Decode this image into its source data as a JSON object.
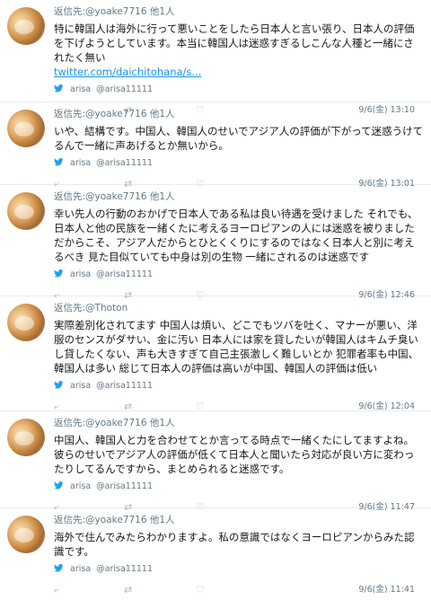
{
  "tweets": [
    {
      "reply_prefix": "返信先:",
      "reply_handle": "@yoake7716",
      "reply_more": "他1人",
      "text": "特に韓国人は海外に行って悪いことをしたら日本人と言い張り、日本人の評価を下げようとしています。本当に韓国人は迷惑すぎるしこんな人種と一緒にされたく無い",
      "link": "twitter.com/daichitohana/s...",
      "via_name": "arisa",
      "via_handle": "@arisa11111",
      "time": "9/6(金) 13:10"
    },
    {
      "reply_prefix": "返信先:",
      "reply_handle": "@yoake7716",
      "reply_more": "他1人",
      "text": "いや、結構です。中国人、韓国人のせいでアジア人の評価が下がって迷惑うけてるんで一緒に声あげるとか無いから。",
      "link": "",
      "via_name": "arisa",
      "via_handle": "@arisa11111",
      "time": "9/6(金) 13:01"
    },
    {
      "reply_prefix": "返信先:",
      "reply_handle": "@yoake7716",
      "reply_more": "他1人",
      "text": "幸い先人の行動のおかげで日本人である私は良い待遇を受けました それでも、日本人と他の民族を一緒くたに考えるヨーロピアンの人には迷惑を被りました だからこそ、アジア人だからとひとくくりにするのではなく日本人と別に考えるべき 見た目似ていても中身は別の生物 一緒にされるのは迷惑です",
      "link": "",
      "via_name": "arisa",
      "via_handle": "@arisa11111",
      "time": "9/6(金) 12:46"
    },
    {
      "reply_prefix": "返信先:",
      "reply_handle": "@Thoton",
      "reply_more": "",
      "text": "実際差別化されてます 中国人は煩い、どこでもツバを吐く、マナーが悪い、洋服のセンスがダサい、金に汚い 日本人には家を貸したいが韓国人はキムチ臭いし貸したくない、声も大きすぎて自己主張激しく難しいとか 犯罪者率も中国、韓国人は多い 総じて日本人の評価は高いが中国、韓国人の評価は低い",
      "link": "",
      "via_name": "arisa",
      "via_handle": "@arisa11111",
      "time": "9/6(金) 12:04"
    },
    {
      "reply_prefix": "返信先:",
      "reply_handle": "@yoake7716",
      "reply_more": "他1人",
      "text": "中国人、韓国人と力を合わせてとか言ってる時点で一緒くたにしてますよね。 彼らのせいでアジア人の評価が低くて日本人と聞いたら対応が良い方に変わったりしてるんですから、まとめられると迷惑です。",
      "link": "",
      "via_name": "arisa",
      "via_handle": "@arisa11111",
      "time": "9/6(金) 11:47"
    },
    {
      "reply_prefix": "返信先:",
      "reply_handle": "@yoake7716",
      "reply_more": "他1人",
      "text": "海外で住んでみたらわかりますよ。私の意識ではなくヨーロピアンからみた認識です。",
      "link": "",
      "via_name": "arisa",
      "via_handle": "@arisa11111",
      "time": "9/6(金) 11:41"
    }
  ],
  "icons": {
    "reply": "⤶",
    "retweet": "⇄",
    "like": "♡"
  },
  "colors": {
    "link": "#1b95e0",
    "muted": "#657786",
    "divider": "#e6ecf0"
  }
}
